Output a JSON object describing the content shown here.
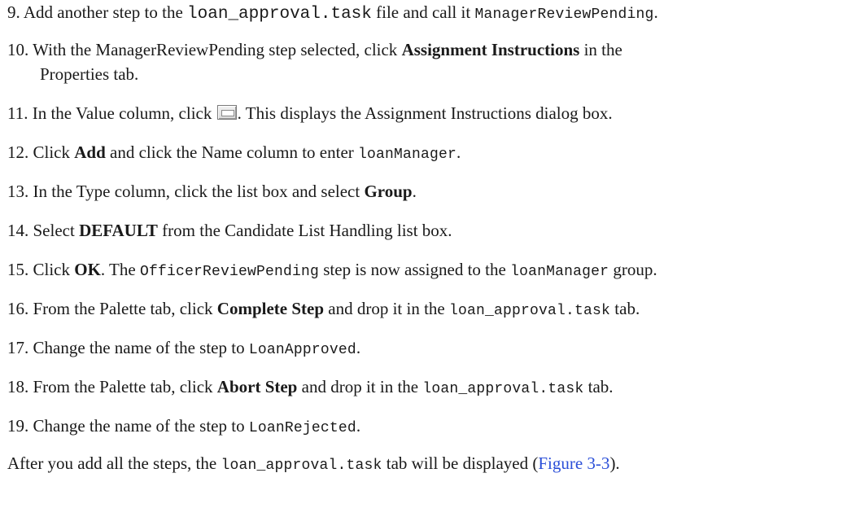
{
  "steps": [
    {
      "num": "9.",
      "t1": "Add another step to the ",
      "c1": "loan_approval.task",
      "t2": " file and call it ",
      "c2": "ManagerReviewPending",
      "t3": "."
    },
    {
      "num": "10.",
      "t1": "With the ManagerReviewPending step selected, click ",
      "b1": "Assignment Instructions",
      "t2": " in the",
      "line2": "Properties tab."
    },
    {
      "num": "11.",
      "t1": "In the Value column, click ",
      "icon": "ellipsis-button-icon",
      "t2": ". This displays the Assignment Instructions dialog box."
    },
    {
      "num": "12.",
      "t1": "Click ",
      "b1": "Add",
      "t2": " and click the Name column to enter ",
      "c1": "loanManager",
      "t3": "."
    },
    {
      "num": "13.",
      "t1": "In the Type column, click the list box and select ",
      "b1": "Group",
      "t2": "."
    },
    {
      "num": "14.",
      "t1": "Select ",
      "b1": "DEFAULT",
      "t2": " from the Candidate List Handling list box."
    },
    {
      "num": "15.",
      "t1": "Click ",
      "b1": "OK",
      "t2": ". The ",
      "c1": "OfficerReviewPending",
      "t3": " step is now assigned to the ",
      "c2": "loanManager",
      "t4": " group."
    },
    {
      "num": "16.",
      "t1": "From the Palette tab, click ",
      "b1": "Complete Step",
      "t2": " and drop it in the ",
      "c1": "loan_approval.task",
      "t3": " tab."
    },
    {
      "num": "17.",
      "t1": "Change the name of the step to ",
      "c1": "LoanApproved",
      "t2": "."
    },
    {
      "num": "18.",
      "t1": "From the Palette tab, click ",
      "b1": "Abort Step",
      "t2": " and drop it in the ",
      "c1": "loan_approval.task",
      "t3": " tab."
    },
    {
      "num": "19.",
      "t1": "Change the name of the step to ",
      "c1": "LoanRejected",
      "t2": "."
    }
  ],
  "closing": {
    "t1": "After you add all the steps, the ",
    "c1": "loan_approval.task",
    "t2": " tab will be displayed (",
    "link": "Figure 3-3",
    "t3": ")."
  },
  "colors": {
    "text": "#1a1a1a",
    "link": "#2b4fd8"
  }
}
